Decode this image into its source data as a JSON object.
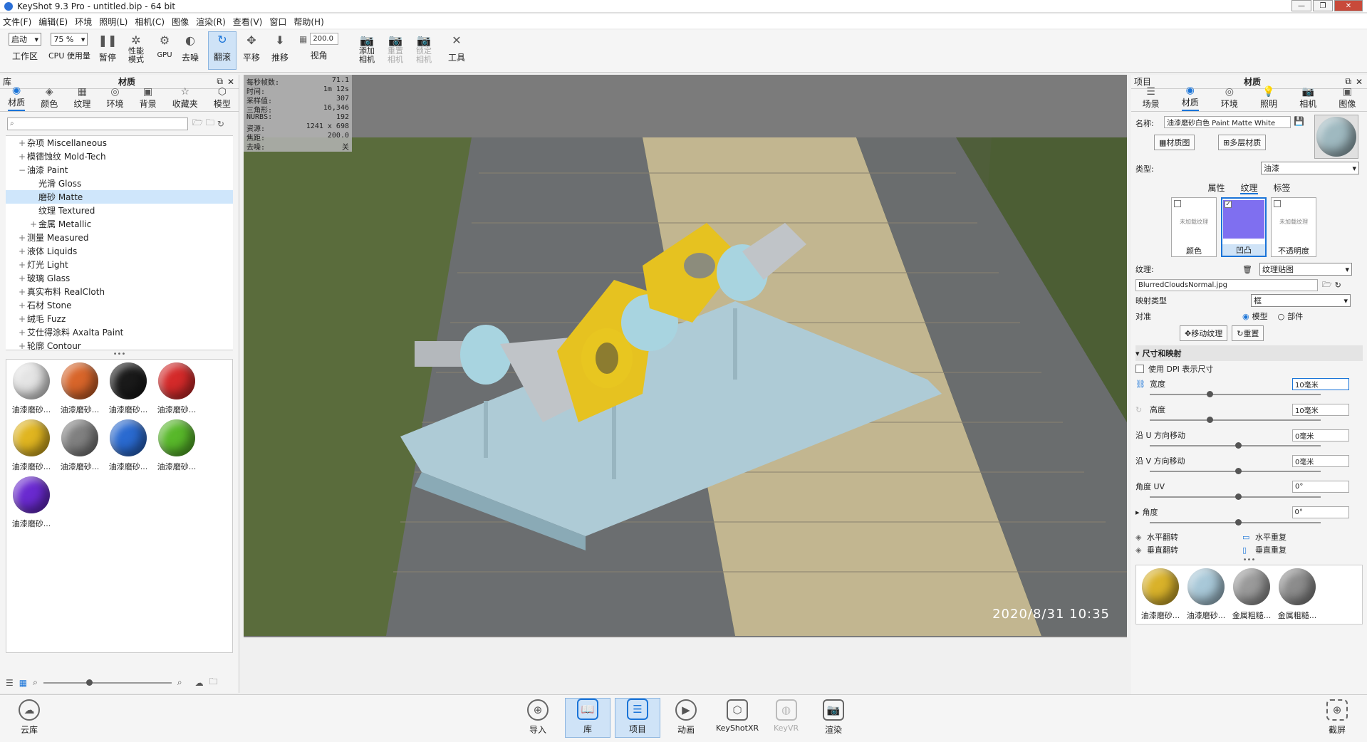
{
  "window": {
    "title": "KeyShot 9.3 Pro  - untitled.bip  - 64 bit"
  },
  "menu": [
    "文件(F)",
    "编辑(E)",
    "环境",
    "照明(L)",
    "相机(C)",
    "图像",
    "渲染(R)",
    "查看(V)",
    "窗口",
    "帮助(H)"
  ],
  "toolbar": {
    "workspace_select": "启动",
    "workspace_label": "工作区",
    "cpu_select": "75 %",
    "cpu_label": "CPU 使用量",
    "pause": "暂停",
    "perf_mode": "性能模式",
    "gpu": "GPU",
    "denoise": "去噪",
    "tumble": "翻滚",
    "pan": "平移",
    "dolly": "推移",
    "fov_value": "200.0",
    "fov_label": "视角",
    "add_camera": "添加相机",
    "reset_camera": "重置相机",
    "lock_camera": "锁定相机",
    "tools": "工具"
  },
  "library": {
    "header_left": "库",
    "header_title": "材质",
    "tabs": [
      "材质",
      "颜色",
      "纹理",
      "环境",
      "背景",
      "收藏夹",
      "模型"
    ],
    "search_placeholder": "",
    "tree": [
      {
        "label": "杂项 Miscellaneous",
        "indent": 1,
        "exp": "+"
      },
      {
        "label": "模德蚀纹 Mold-Tech",
        "indent": 1,
        "exp": "+"
      },
      {
        "label": "油漆 Paint",
        "indent": 1,
        "exp": "−"
      },
      {
        "label": "光滑 Gloss",
        "indent": 2,
        "exp": ""
      },
      {
        "label": "磨砂 Matte",
        "indent": 2,
        "exp": "",
        "selected": true
      },
      {
        "label": "纹理 Textured",
        "indent": 2,
        "exp": ""
      },
      {
        "label": "金属 Metallic",
        "indent": 2,
        "exp": "+"
      },
      {
        "label": "测量 Measured",
        "indent": 1,
        "exp": "+"
      },
      {
        "label": "液体 Liquids",
        "indent": 1,
        "exp": "+"
      },
      {
        "label": "灯光 Light",
        "indent": 1,
        "exp": "+"
      },
      {
        "label": "玻璃 Glass",
        "indent": 1,
        "exp": "+"
      },
      {
        "label": "真实布料 RealCloth",
        "indent": 1,
        "exp": "+"
      },
      {
        "label": "石材 Stone",
        "indent": 1,
        "exp": "+"
      },
      {
        "label": "绒毛 Fuzz",
        "indent": 1,
        "exp": "+"
      },
      {
        "label": "艾仕得涂料 Axalta Paint",
        "indent": 1,
        "exp": "+"
      },
      {
        "label": "轮廓 Contour",
        "indent": 1,
        "exp": "+"
      }
    ],
    "thumbnails": [
      {
        "label": "油漆磨砂...",
        "color": "#e4e4e4"
      },
      {
        "label": "油漆磨砂...",
        "color": "#d8652a"
      },
      {
        "label": "油漆磨砂...",
        "color": "#1a1a1a"
      },
      {
        "label": "油漆磨砂...",
        "color": "#d42a2a"
      },
      {
        "label": "油漆磨砂...",
        "color": "#e0b520"
      },
      {
        "label": "油漆磨砂...",
        "color": "#808080"
      },
      {
        "label": "油漆磨砂...",
        "color": "#2a6ad0"
      },
      {
        "label": "油漆磨砂...",
        "color": "#58b82a"
      },
      {
        "label": "油漆磨砂...",
        "color": "#6a2ad0"
      }
    ]
  },
  "viewport": {
    "stats": [
      {
        "k": "每秒帧数:",
        "v": "71.1"
      },
      {
        "k": "时间:",
        "v": "1m 12s"
      },
      {
        "k": "采样值:",
        "v": "307"
      },
      {
        "k": "三角形:",
        "v": "16,346"
      },
      {
        "k": "NURBS:",
        "v": "192"
      },
      {
        "k": "资源:",
        "v": "1241 x 698"
      },
      {
        "k": "焦距:",
        "v": "200.0"
      },
      {
        "k": "去噪:",
        "v": "关"
      }
    ],
    "timestamp": "2020/8/31  10:35"
  },
  "project": {
    "header_left": "项目",
    "header_title": "材质",
    "tabs": [
      "场景",
      "材质",
      "环境",
      "照明",
      "相机",
      "图像"
    ],
    "name_label": "名称:",
    "name_value": "油漆磨砂白色 Paint Matte White",
    "graph_btn": "材质图",
    "multi_btn": "多层材质",
    "type_label": "类型:",
    "type_value": "油漆",
    "subtabs": [
      "属性",
      "纹理",
      "标签"
    ],
    "slots": [
      {
        "label": "颜色",
        "note": "未加载纹理"
      },
      {
        "label": "凹凸",
        "note": ""
      },
      {
        "label": "不透明度",
        "note": "未加载纹理"
      }
    ],
    "texture_label": "纹理:",
    "texture_type": "纹理贴图",
    "texture_file": "BlurredCloudsNormal.jpg",
    "map_type_label": "映射类型",
    "map_type_value": "框",
    "align_label": "对准",
    "align_model": "模型",
    "align_part": "部件",
    "move_tex": "移动纹理",
    "reset": "重置",
    "size_section": "尺寸和映射",
    "dpi_label": "使用 DPI 表示尺寸",
    "width_label": "宽度",
    "width_value": "10毫米",
    "height_label": "高度",
    "height_value": "10毫米",
    "u_label": "沿 U 方向移动",
    "u_value": "0毫米",
    "v_label": "沿 V 方向移动",
    "v_value": "0毫米",
    "angle_uv_label": "角度 UV",
    "angle_uv_value": "0°",
    "angle_label": "角度",
    "angle_value": "0°",
    "hflip": "水平翻转",
    "hrepeat": "水平重复",
    "vflip": "垂直翻转",
    "vrepeat": "垂直重复",
    "thumbs": [
      {
        "label": "油漆磨砂...",
        "color": "#d9b22a"
      },
      {
        "label": "油漆磨砂...",
        "color": "#a8c8d8"
      },
      {
        "label": "金属粗糙...",
        "color": "#9a9a9a"
      },
      {
        "label": "金属粗糙...",
        "color": "#8c8c8c"
      }
    ]
  },
  "bottom": {
    "cloud": "云库",
    "import": "导入",
    "library": "库",
    "project": "项目",
    "animation": "动画",
    "keyshotxr": "KeyShotXR",
    "keyvr": "KeyVR",
    "render": "渲染",
    "screenshot": "截屏"
  }
}
